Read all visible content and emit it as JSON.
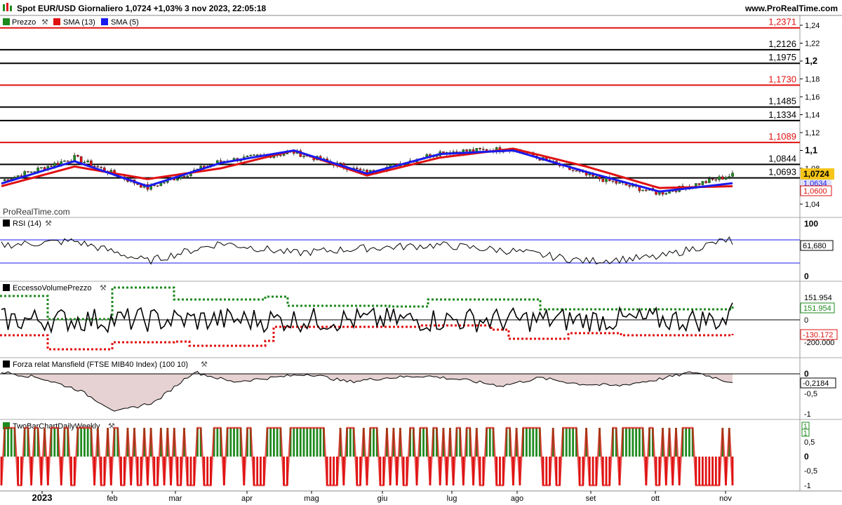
{
  "header": {
    "title": "Spot EUR/USD Giornaliero 1,0724 +1,03% 3 nov 2023, 22:05:18",
    "website": "www.ProRealTime.com"
  },
  "watermark": "ProRealTime.com",
  "colors": {
    "green": "#1e8a1e",
    "red": "#e01010",
    "blue": "#1a1aee",
    "black": "#000000",
    "gray_axis": "#888888",
    "mansfield_fill": "#e6d2d2"
  },
  "price_panel": {
    "legend": [
      {
        "label": "Prezzo",
        "color": "#1e8a1e",
        "icon": "wrench-icon"
      },
      {
        "label": "SMA (13)",
        "color": "#e01010"
      },
      {
        "label": "SMA (5)",
        "color": "#1a1aee"
      }
    ],
    "ticks": [
      "1,24",
      "1,22",
      "1,2",
      "1,18",
      "1,16",
      "1,14",
      "1,12",
      "1,1",
      "1,08",
      "1,06",
      "1,04"
    ],
    "tick_values": [
      1.24,
      1.22,
      1.2,
      1.18,
      1.16,
      1.14,
      1.12,
      1.1,
      1.08,
      1.06,
      1.04
    ],
    "bold_ticks": [
      "1,2",
      "1,1"
    ],
    "levels": [
      {
        "label": "1,2371",
        "value": 1.2371,
        "color": "red"
      },
      {
        "label": "1,2126",
        "value": 1.2126,
        "color": "black"
      },
      {
        "label": "1,1975",
        "value": 1.1975,
        "color": "black"
      },
      {
        "label": "1,1730",
        "value": 1.173,
        "color": "red"
      },
      {
        "label": "1,1485",
        "value": 1.1485,
        "color": "black"
      },
      {
        "label": "1,1334",
        "value": 1.1334,
        "color": "black"
      },
      {
        "label": "1,1089",
        "value": 1.1089,
        "color": "red"
      },
      {
        "label": "1,0844",
        "value": 1.0844,
        "color": "black"
      },
      {
        "label": "1,0693",
        "value": 1.0693,
        "color": "black"
      }
    ],
    "price_badge": "1,0724",
    "sma5_badge": "1,0634",
    "sma13_badge": "1,0600"
  },
  "rsi_panel": {
    "legend": "RSI (14)",
    "ticks": [
      "100",
      "0"
    ],
    "value_label": "61,680",
    "bands": [
      70,
      30
    ]
  },
  "evp_panel": {
    "legend": "EccessoVolumePrezzo",
    "labels": [
      "151.954",
      "151.954",
      "0",
      "-130.172",
      "-200.000"
    ]
  },
  "mansfield_panel": {
    "legend": "Forza relat Mansfield (FTSE MIB40 Index) (100 10)",
    "ticks": [
      "0",
      "-0,5",
      "-1"
    ],
    "value_label": "-0,2184"
  },
  "twobar_panel": {
    "legend": "TwoBarChartDailyWeekly",
    "ticks": [
      "0,5",
      "0",
      "-0,5",
      "-1"
    ],
    "top_labels": [
      "1",
      "1"
    ]
  },
  "x_axis": {
    "labels": [
      "2023",
      "feb",
      "mar",
      "apr",
      "mag",
      "giu",
      "lug",
      "ago",
      "set",
      "ott",
      "nov"
    ]
  },
  "chart_data": {
    "type": "line",
    "title": "Spot EUR/USD Giornaliero",
    "x": [
      "2023",
      "feb",
      "mar",
      "apr",
      "mag",
      "giu",
      "lug",
      "ago",
      "set",
      "ott",
      "nov"
    ],
    "series": [
      {
        "name": "Prezzo",
        "values": [
          1.066,
          1.092,
          1.058,
          1.088,
          1.098,
          1.075,
          1.098,
          1.102,
          1.072,
          1.052,
          1.0724
        ]
      },
      {
        "name": "SMA (13)",
        "values": [
          1.06,
          1.082,
          1.068,
          1.08,
          1.1,
          1.072,
          1.092,
          1.102,
          1.082,
          1.058,
          1.06
        ]
      },
      {
        "name": "SMA (5)",
        "values": [
          1.063,
          1.088,
          1.06,
          1.086,
          1.1,
          1.074,
          1.096,
          1.1,
          1.076,
          1.054,
          1.0634
        ]
      }
    ],
    "ylim": [
      1.03,
      1.245
    ]
  }
}
